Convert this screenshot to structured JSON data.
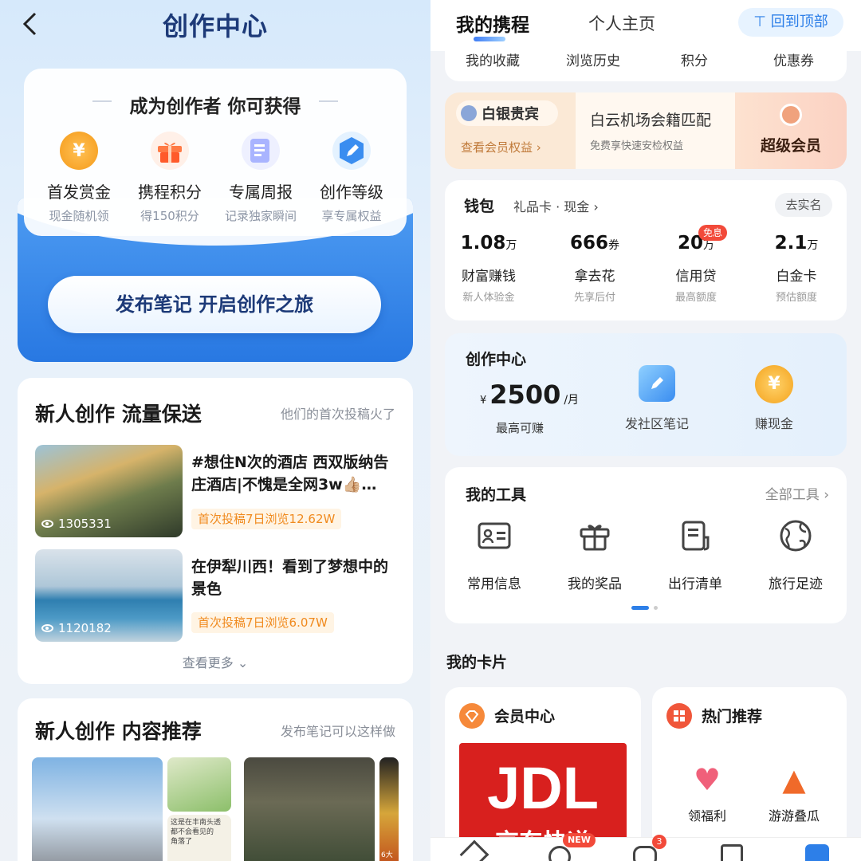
{
  "left": {
    "title": "创作中心",
    "perks_heading": "成为创作者 你可获得",
    "perks": [
      {
        "title": "首发赏金",
        "sub": "现金随机领",
        "icon": "coin-icon",
        "glyph": "¥"
      },
      {
        "title": "携程积分",
        "sub": "得150积分",
        "icon": "gift-icon",
        "glyph": ""
      },
      {
        "title": "专属周报",
        "sub": "记录独家瞬间",
        "icon": "report-icon",
        "glyph": ""
      },
      {
        "title": "创作等级",
        "sub": "享专属权益",
        "icon": "pen-badge-icon",
        "glyph": ""
      }
    ],
    "publish_btn": "发布笔记 开启创作之旅",
    "section1": {
      "title": "新人创作 流量保送",
      "subtitle": "他们的首次投稿火了",
      "posts": [
        {
          "title": "#想住N次的酒店 西双版纳告庄酒店|不愧是全网3w👍🏼…",
          "views": "1305331",
          "tag": "首次投稿7日浏览12.62W"
        },
        {
          "title": "在伊犁川西！看到了梦想中的景色",
          "views": "1120182",
          "tag": "首次投稿7日浏览6.07W"
        }
      ],
      "more": "查看更多"
    },
    "section2": {
      "title": "新人创作 内容推荐",
      "subtitle": "发布笔记可以这样做",
      "snippet1": "这是在丰南头透",
      "snippet2": "都不会看见的",
      "snippet3": "角落了",
      "snippet4": "6大"
    }
  },
  "right": {
    "tabs": [
      "我的携程",
      "个人主页"
    ],
    "back_to_top": "回到顶部",
    "quick": [
      "我的收藏",
      "浏览历史",
      "积分",
      "优惠券"
    ],
    "vip": {
      "level": "白银贵宾",
      "link": "查看会员权益",
      "promo_title": "白云机场会籍匹配",
      "promo_sub": "免费享快速安检权益",
      "super": "超级会员"
    },
    "wallet": {
      "title": "钱包",
      "sub": "礼品卡 · 现金",
      "action": "去实名",
      "items": [
        {
          "value": "1.08",
          "unit": "万",
          "label": "财富赚钱",
          "sub": "新人体验金",
          "badge": ""
        },
        {
          "value": "666",
          "unit": "券",
          "label": "拿去花",
          "sub": "先享后付",
          "badge": ""
        },
        {
          "value": "20",
          "unit": "万",
          "label": "信用贷",
          "sub": "最高额度",
          "badge": "免息"
        },
        {
          "value": "2.1",
          "unit": "万",
          "label": "白金卡",
          "sub": "预估额度",
          "badge": ""
        }
      ]
    },
    "creator": {
      "title": "创作中心",
      "currency": "¥",
      "amount": "2500",
      "unit": "/月",
      "amount_label": "最高可赚",
      "actions": [
        {
          "label": "发社区笔记",
          "icon": "note-icon"
        },
        {
          "label": "赚现金",
          "icon": "coin-icon"
        }
      ]
    },
    "tools": {
      "title": "我的工具",
      "all": "全部工具",
      "items": [
        {
          "label": "常用信息",
          "icon": "id-card-icon"
        },
        {
          "label": "我的奖品",
          "icon": "gift-icon"
        },
        {
          "label": "出行清单",
          "icon": "checklist-icon"
        },
        {
          "label": "旅行足迹",
          "icon": "globe-icon"
        }
      ]
    },
    "cards_title": "我的卡片",
    "cards": [
      {
        "title": "会员中心",
        "icon": "member-icon",
        "banner": "JDL",
        "banner_sub": "京东快递"
      },
      {
        "title": "热门推荐",
        "icon": "grid-icon",
        "items": [
          "领福利",
          "游游叠瓜"
        ]
      }
    ],
    "nav_badges": {
      "new": "NEW",
      "count": "3"
    }
  },
  "colors": {
    "brand": "#2878e2",
    "title": "#1d3a78",
    "orange": "#f08a1e"
  }
}
